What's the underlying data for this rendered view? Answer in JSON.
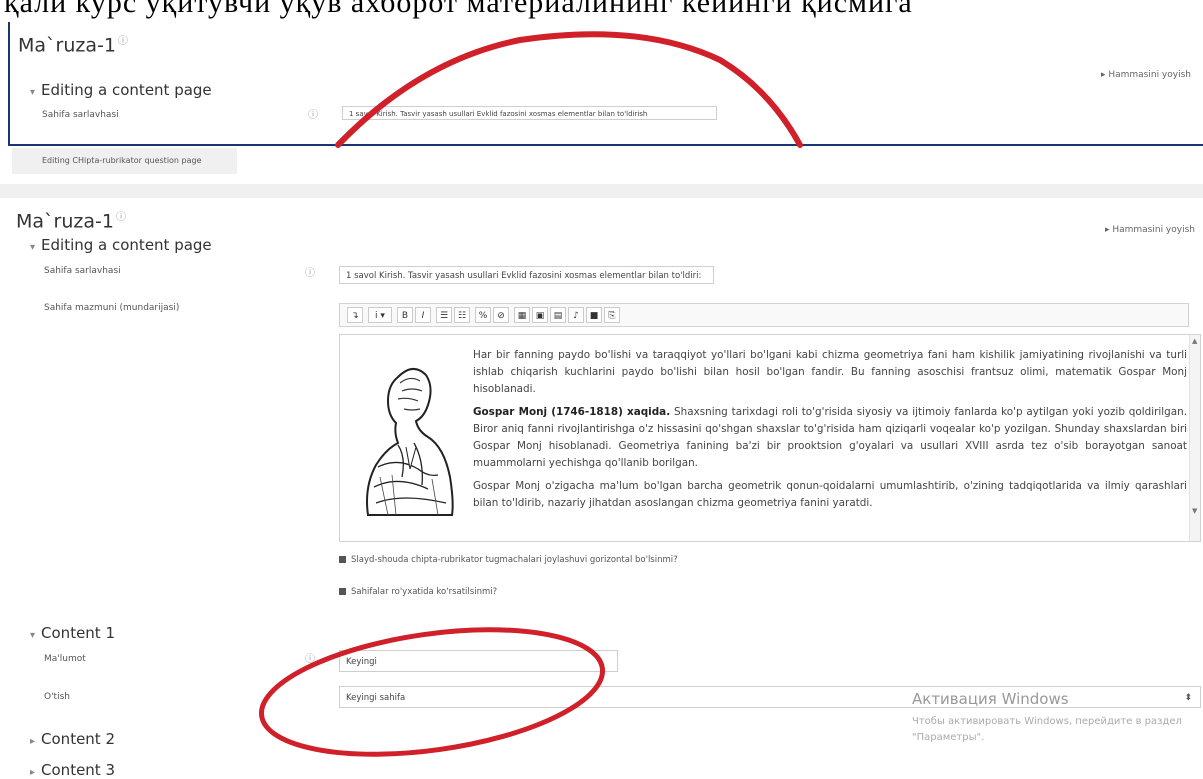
{
  "doc_heading": "қали курс ўқитувчи ўқув ахборот материалининг кейинги қисмига",
  "top": {
    "title": "Ma`ruza-1",
    "expand_all": "▸ Hammasini yoyish",
    "section": "Editing a content page",
    "title_label": "Sahifa sarlavhasi",
    "title_value": "1 savol Kirish. Tasvir yasash usullari Evklid fazosini xosmas elementlar bilan to'ldirish"
  },
  "strip_text": "Editing CHipta-rubrikator question page",
  "main": {
    "title": "Ma`ruza-1",
    "expand_all": "▸ Hammasini yoyish",
    "section": "Editing a content page",
    "title_label": "Sahifa sarlavhasi",
    "title_value": "1 savol Kirish. Tasvir yasash usullari Evklid fazosini xosmas elementlar bilan to'ldiri:",
    "content_label": "Sahifa mazmuni (mundarijasi)",
    "toolbar": [
      "↴",
      "i ▾",
      "B",
      "I",
      "☰",
      "☷",
      "%",
      "⊘",
      "▦",
      "▣",
      "▤",
      "♪",
      "■",
      "⎘"
    ],
    "paragraphs": [
      {
        "bold": "",
        "text": "Har bir fanning paydo bo'lishi va taraqqiyot yo'llari bo'lgani kabi chizma geometriya fani ham kishilik jamiyatining rivojlanishi va turli ishlab chiqarish kuchlarini paydo bo'lishi bilan hosil bo'lgan fandir. Bu fanning asoschisi frantsuz olimi, matematik Gospar Monj hisoblanadi."
      },
      {
        "bold": "Gospar Monj (1746-1818) xaqida.",
        "text": " Shaxsning tarixdagi roli to'g'risida siyosiy va ijtimoiy fanlarda ko'p aytilgan yoki yozib qoldirilgan. Biror aniq fanni rivojlantirishga o'z hissasini qo'shgan shaxslar to'g'risida ham qiziqarli voqealar ko'p yozilgan. Shunday shaxslardan biri Gospar Monj hisoblanadi. Geometriya fanining ba'zi bir prooktsion g'oyalari va usullari XVIII asrda tez o'sib borayotgan sanoat muammolarni yechishga qo'llanib borilgan."
      },
      {
        "bold": "",
        "text": "Gospar Monj o'zigacha ma'lum bo'lgan barcha geometrik qonun-qoidalarni umumlashtirib, o'zining tadqiqotlarida va ilmiy qarashlari bilan to'ldirib, nazariy jihatdan asoslangan chizma geometriya fanini yaratdi."
      }
    ],
    "checkbox1": "Slayd-shouda chipta-rubrikator tugmachalari joylashuvi gorizontal bo'lsinmi?",
    "checkbox2": "Sahifalar ro'yxatida ko'rsatilsinmi?"
  },
  "content1": {
    "header": "Content 1",
    "info_label": "Ma'lumot",
    "info_value": "Keyingi",
    "jump_label": "O'tish",
    "jump_value": "Keyingi sahifa"
  },
  "content2": "Content 2",
  "content3": "Content 3",
  "watermark": {
    "title": "Активация Windows",
    "text": "Чтобы активировать Windows, перейдите в раздел \"Параметры\"."
  },
  "colors": {
    "accent_border": "#1a3570",
    "annotation": "#d0202a"
  }
}
